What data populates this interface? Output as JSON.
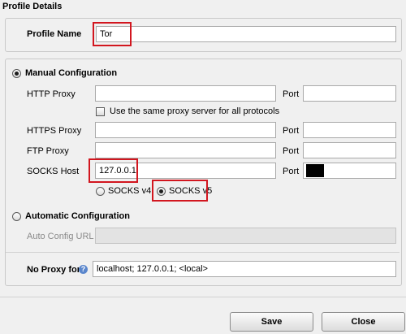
{
  "title": "Profile Details",
  "profile": {
    "label": "Profile Name",
    "value": "Tor"
  },
  "manual": {
    "label": "Manual Configuration",
    "selected": true,
    "http_label": "HTTP Proxy",
    "http_value": "",
    "http_port_label": "Port",
    "http_port": "",
    "same_proxy_label": "Use the same proxy server for all protocols",
    "same_proxy_checked": false,
    "https_label": "HTTPS Proxy",
    "https_value": "",
    "https_port_label": "Port",
    "https_port": "",
    "ftp_label": "FTP Proxy",
    "ftp_value": "",
    "ftp_port_label": "Port",
    "ftp_port": "",
    "socks_label": "SOCKS Host",
    "socks_value": "127.0.0.1",
    "socks_port_label": "Port",
    "socks_port": "",
    "socks_v4_label": "SOCKS v4",
    "socks_v5_label": "SOCKS v5",
    "socks_version_selected": "SOCKS v5"
  },
  "automatic": {
    "label": "Automatic Configuration",
    "selected": false,
    "url_label": "Auto Config URL",
    "url_value": ""
  },
  "no_proxy": {
    "label": "No Proxy for",
    "value": "localhost; 127.0.0.1; <local>",
    "help_icon": "?"
  },
  "buttons": {
    "save": "Save",
    "close": "Close"
  },
  "colors": {
    "highlight": "#d2161f",
    "help_icon": "#5a86cc"
  }
}
